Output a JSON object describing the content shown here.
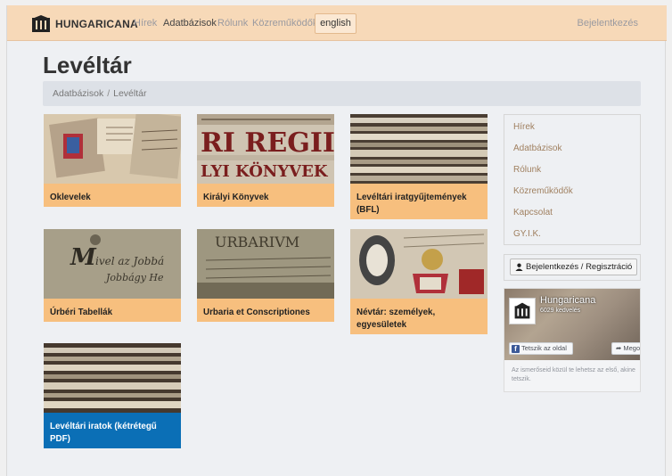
{
  "brand": {
    "name": "HUNGARICANA"
  },
  "nav": {
    "items": [
      "Hírek",
      "Adatbázisok",
      "Rólunk",
      "Közreműködők"
    ],
    "language": "english",
    "login": "Bejelentkezés"
  },
  "page": {
    "title": "Levéltár"
  },
  "breadcrumb": {
    "items": [
      "Adatbázisok",
      "Levéltár"
    ],
    "separator": "/"
  },
  "cards": [
    {
      "label": "Oklevelek"
    },
    {
      "label": "Királyi Könyvek"
    },
    {
      "label": "Levéltári iratgyűjtemények (BFL)"
    },
    {
      "label": "Úrbéri Tabellák"
    },
    {
      "label": "Urbaria et Conscriptiones"
    },
    {
      "label": "Névtár: személyek, egyesületek"
    },
    {
      "label": "Levéltári iratok (kétrétegű PDF)"
    }
  ],
  "sidebar": {
    "items": [
      "Hírek",
      "Adatbázisok",
      "Rólunk",
      "Közreműködők",
      "Kapcsolat",
      "GY.I.K."
    ],
    "login_button": "Bejelentkezés / Regisztráció"
  },
  "facebook": {
    "page_name": "Hungaricana",
    "likes": "6029 kedvelés",
    "like_button": "Tetszik az oldal",
    "share_button": "Mego",
    "text": "Az ismerőseid közül te lehetsz az első, akine tetszik."
  },
  "colors": {
    "navbar": "#f7d9b8",
    "card_label": "#f7bf7e",
    "card_label_selected": "#0b6fb6"
  }
}
